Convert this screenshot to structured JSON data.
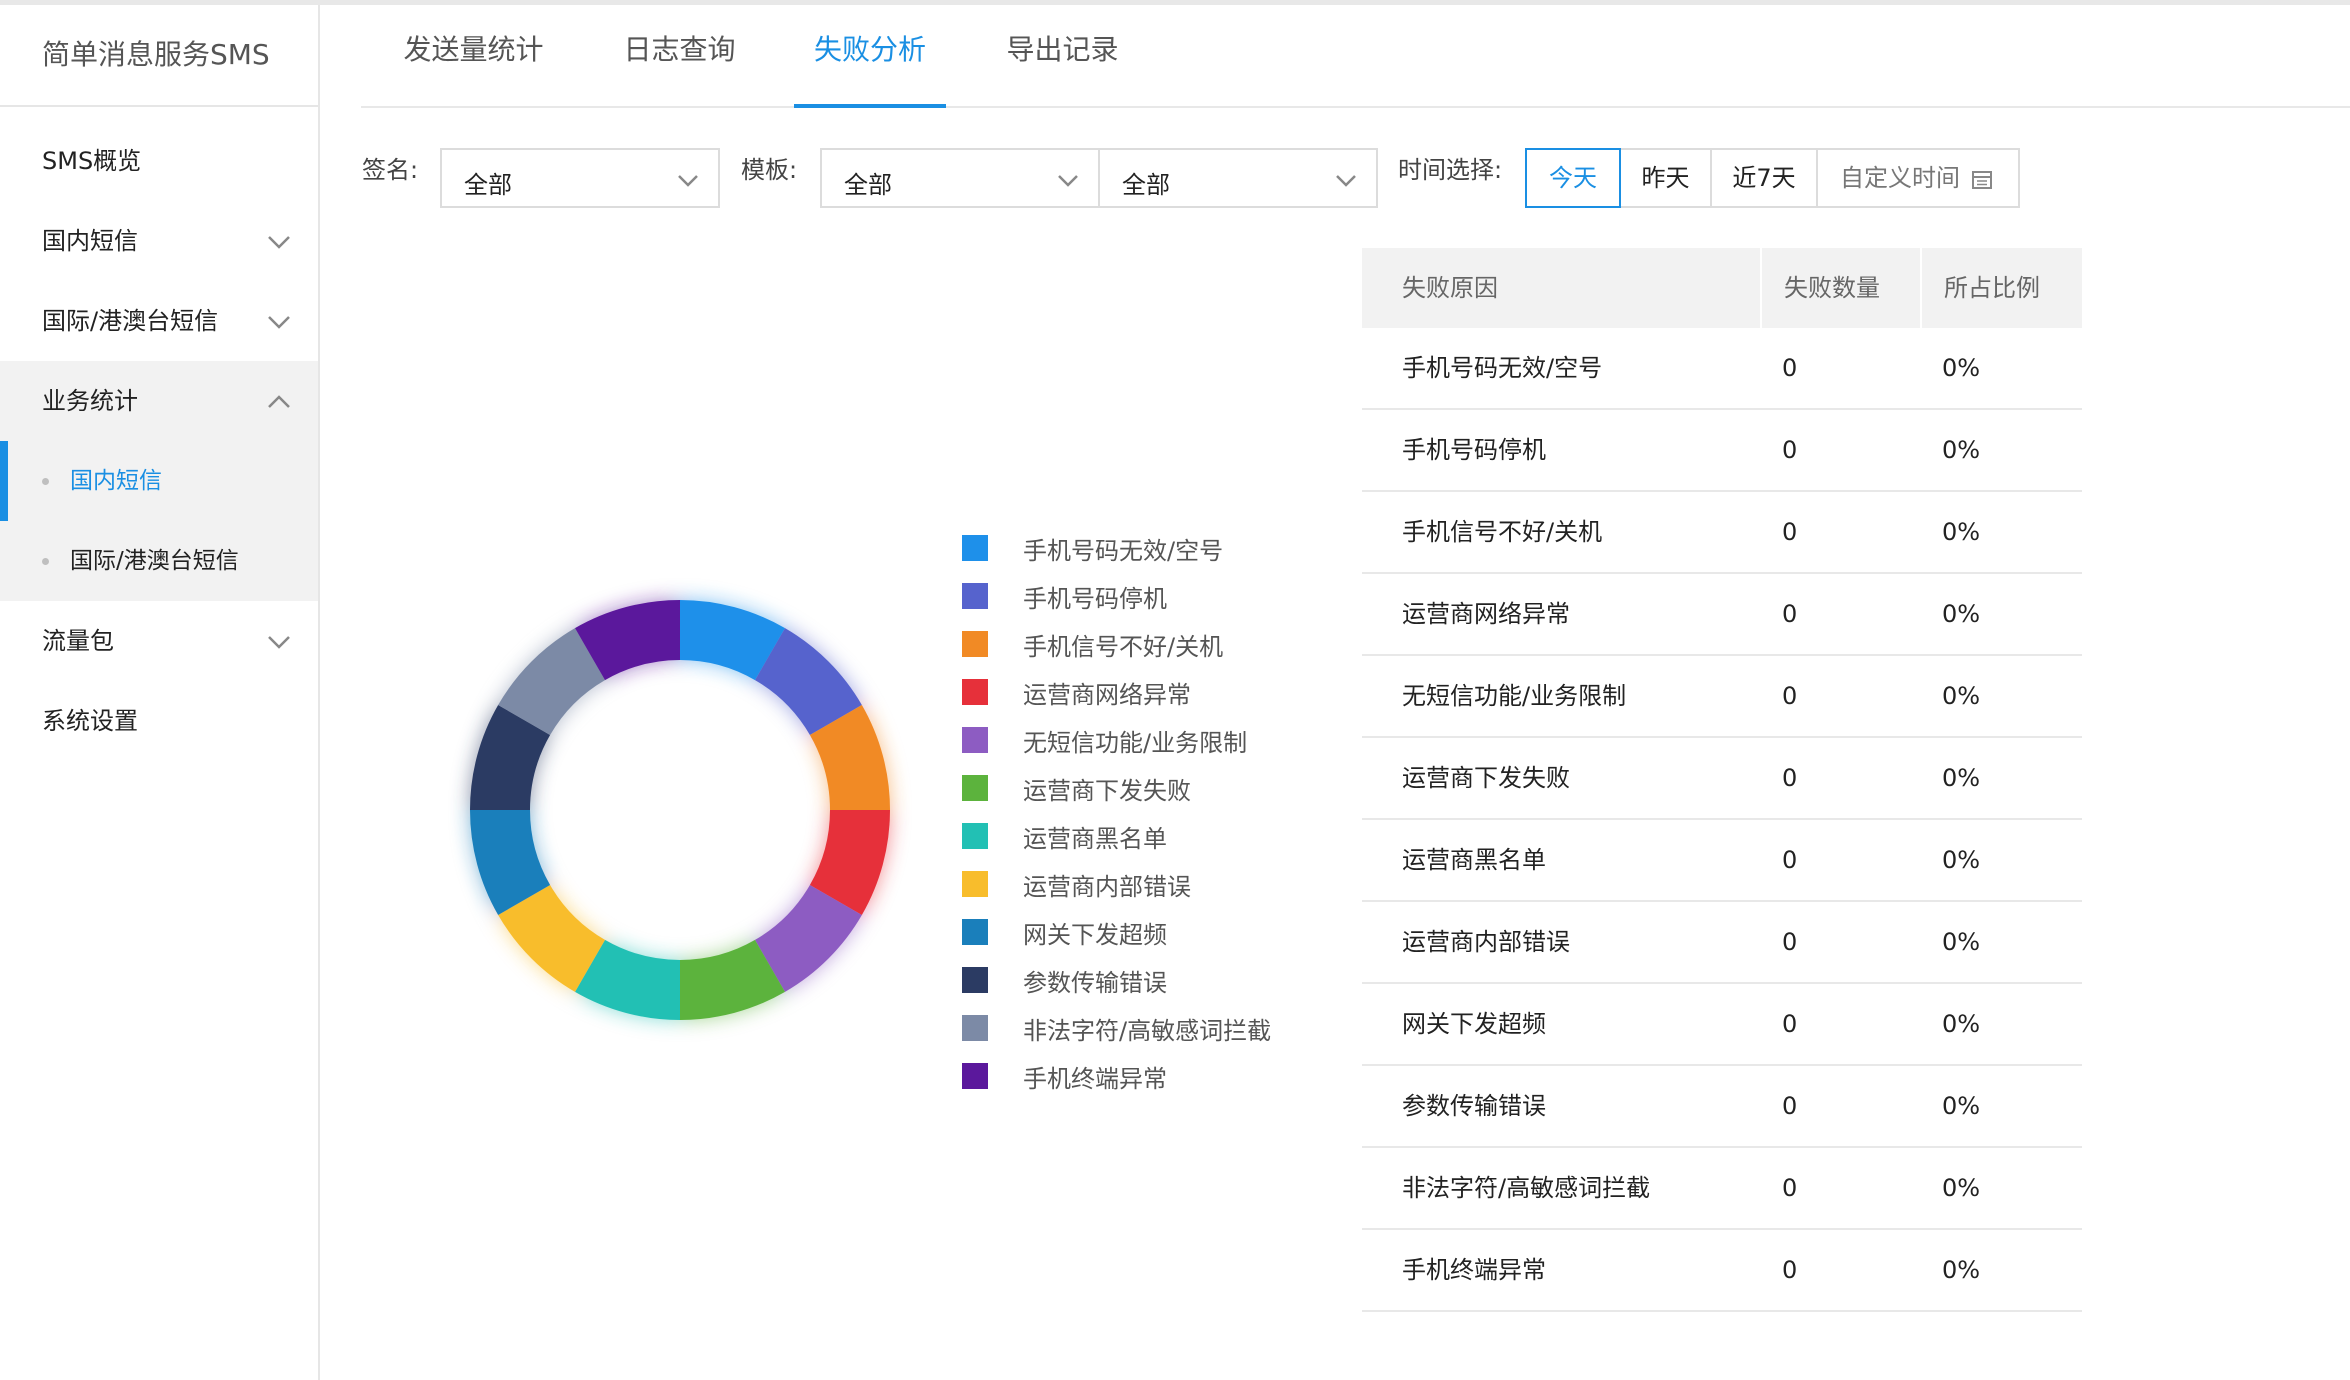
{
  "app_title": "简单消息服务SMS",
  "sidebar": {
    "overview": "SMS概览",
    "domestic": "国内短信",
    "international": "国际/港澳台短信",
    "stats": "业务统计",
    "stats_children": [
      "国内短信",
      "国际/港澳台短信"
    ],
    "traffic": "流量包",
    "settings": "系统设置"
  },
  "tabs": [
    "发送量统计",
    "日志查询",
    "失败分析",
    "导出记录"
  ],
  "filters": {
    "signature_label": "签名:",
    "signature_value": "全部",
    "template_label": "模板:",
    "template_value_1": "全部",
    "template_value_2": "全部",
    "time_label": "时间选择:",
    "time_options": [
      "今天",
      "昨天",
      "近7天",
      "自定义时间"
    ],
    "time_selected": "今天"
  },
  "table": {
    "headers": [
      "失败原因",
      "失败数量",
      "所占比例"
    ],
    "rows": [
      [
        "手机号码无效/空号",
        "0",
        "0%"
      ],
      [
        "手机号码停机",
        "0",
        "0%"
      ],
      [
        "手机信号不好/关机",
        "0",
        "0%"
      ],
      [
        "运营商网络异常",
        "0",
        "0%"
      ],
      [
        "无短信功能/业务限制",
        "0",
        "0%"
      ],
      [
        "运营商下发失败",
        "0",
        "0%"
      ],
      [
        "运营商黑名单",
        "0",
        "0%"
      ],
      [
        "运营商内部错误",
        "0",
        "0%"
      ],
      [
        "网关下发超频",
        "0",
        "0%"
      ],
      [
        "参数传输错误",
        "0",
        "0%"
      ],
      [
        "非法字符/高敏感词拦截",
        "0",
        "0%"
      ],
      [
        "手机终端异常",
        "0",
        "0%"
      ]
    ]
  },
  "chart_data": {
    "type": "pie",
    "categories": [
      "手机号码无效/空号",
      "手机号码停机",
      "手机信号不好/关机",
      "运营商网络异常",
      "无短信功能/业务限制",
      "运营商下发失败",
      "运营商黑名单",
      "运营商内部错误",
      "网关下发超频",
      "参数传输错误",
      "非法字符/高敏感词拦截",
      "手机终端异常"
    ],
    "values": [
      1,
      1,
      1,
      1,
      1,
      1,
      1,
      1,
      1,
      1,
      1,
      1
    ],
    "colors": [
      "#1e90ea",
      "#5663cd",
      "#f18a25",
      "#e6303a",
      "#8d5cc2",
      "#5cb33d",
      "#22c0b4",
      "#f8bd2c",
      "#1a7fbb",
      "#2b3b63",
      "#7c8aa6",
      "#5b189c"
    ],
    "legend": "right"
  }
}
